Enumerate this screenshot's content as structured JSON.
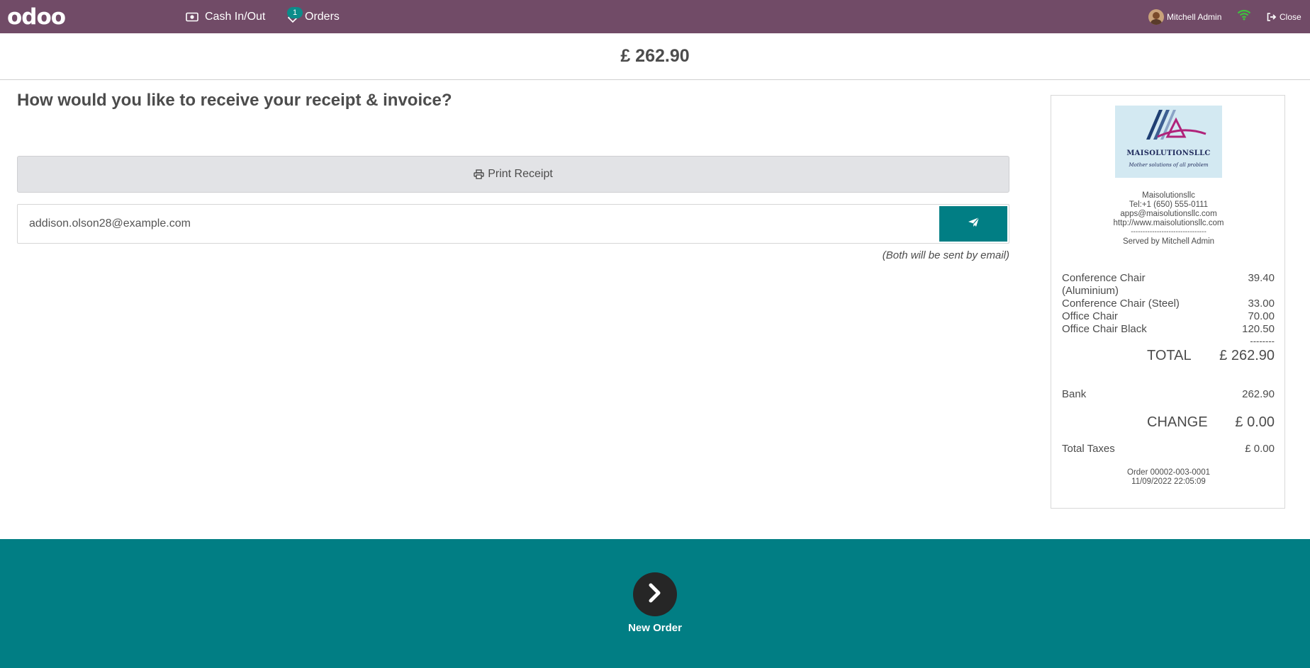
{
  "navbar": {
    "logo_text": "odoo",
    "cash_label": "Cash In/Out",
    "orders_label": "Orders",
    "orders_badge": "1",
    "user_name": "Mitchell Admin",
    "close_label": "Close",
    "background_color": "#714B67"
  },
  "payment": {
    "amount": "£ 262.90",
    "question": "How would you like to receive your receipt & invoice?",
    "print_label": "Print Receipt",
    "email_value": "addison.olson28@example.com",
    "email_note": "(Both will be sent by email)"
  },
  "receipt": {
    "logo_name": "MAISOLUTIONSLLC",
    "logo_tagline": "Mother solutions of all problem",
    "company": "Maisolutionsllc",
    "phone": "Tel:+1 (650) 555-0111",
    "email": "apps@maisolutionsllc.com",
    "website": "http://www.maisolutionsllc.com",
    "separator": "--------------------------------",
    "served_by": "Served by Mitchell Admin",
    "lines": [
      {
        "name": "Conference Chair (Aluminium)",
        "price": "39.40"
      },
      {
        "name": "Conference Chair (Steel)",
        "price": "33.00"
      },
      {
        "name": "Office Chair",
        "price": "70.00"
      },
      {
        "name": "Office Chair Black",
        "price": "120.50"
      }
    ],
    "dashes": "--------",
    "total_label": "TOTAL",
    "total_value": "£ 262.90",
    "payment_method": "Bank",
    "payment_amount": "262.90",
    "change_label": "CHANGE",
    "change_value": "£ 0.00",
    "taxes_label": "Total Taxes",
    "taxes_value": "£ 0.00",
    "order_ref": "Order 00002-003-0001",
    "order_date": "11/09/2022 22:05:09"
  },
  "footer": {
    "new_order_label": "New Order",
    "background_color": "#017e84"
  }
}
